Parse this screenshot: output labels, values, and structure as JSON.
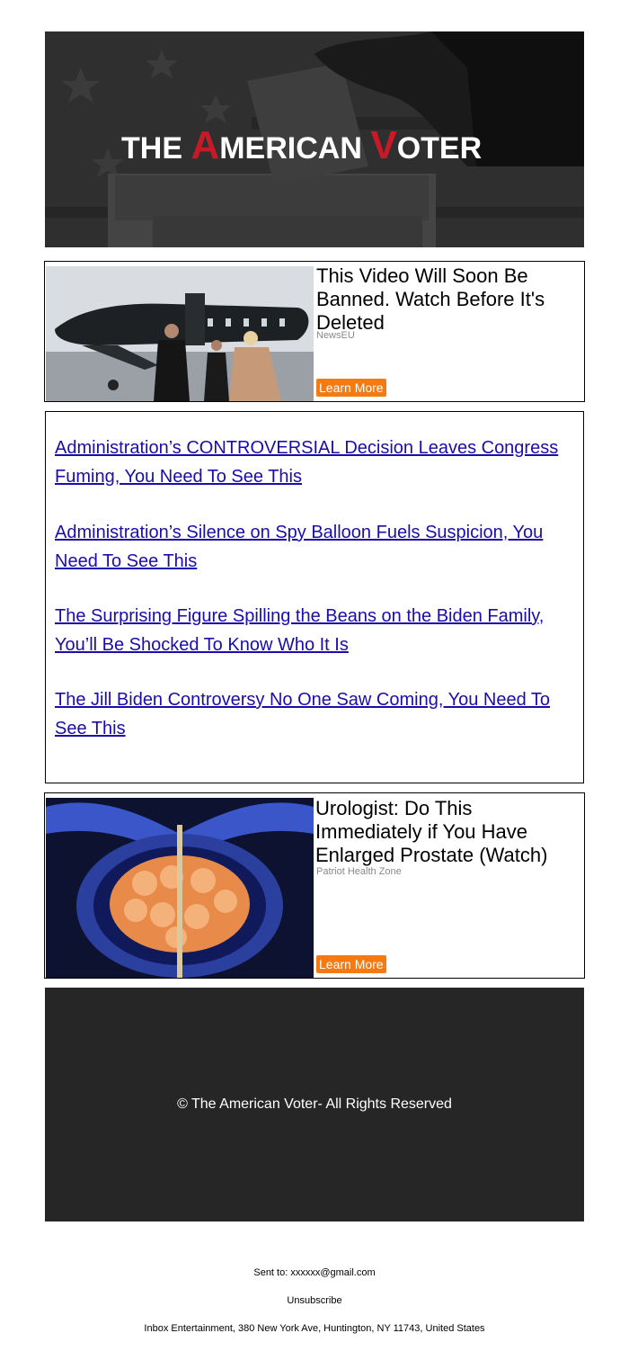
{
  "header": {
    "logo_text": "THE AMERICAN VOTER",
    "logo_parts": {
      "w1": "THE ",
      "a_cap": "A",
      "w2": "MERICAN ",
      "v_cap": "V",
      "w3": "OTER"
    }
  },
  "ad_top": {
    "title": "This Video Will Soon Be Banned. Watch Before It's Deleted",
    "source": "NewsEU",
    "button": "Learn More"
  },
  "links": [
    "Administration’s CONTROVERSIAL Decision Leaves Congress Fuming, You Need To See This",
    "Administration’s Silence on Spy Balloon Fuels Suspicion, You Need To See This",
    "The Surprising Figure Spilling the Beans on the Biden Family, You’ll Be Shocked To Know Who It Is",
    "The Jill Biden Controversy No One Saw Coming, You Need To See This"
  ],
  "ad_bottom": {
    "title": "Urologist: Do This Immediately if You Have Enlarged Prostate (Watch)",
    "source": "Patriot Health Zone",
    "button": "Learn More"
  },
  "footer": {
    "copyright": "© The American Voter- All Rights Reserved",
    "sent_to": "Sent to: xxxxxx@gmail.com",
    "unsubscribe": "Unsubscribe",
    "address": "Inbox Entertainment, 380 New York Ave, Huntington, NY 11743, United States"
  },
  "colors": {
    "brand_red": "#c81a26",
    "button_orange": "#f57a12",
    "link_blue": "#1a0dab",
    "footer_bg": "#262626"
  }
}
